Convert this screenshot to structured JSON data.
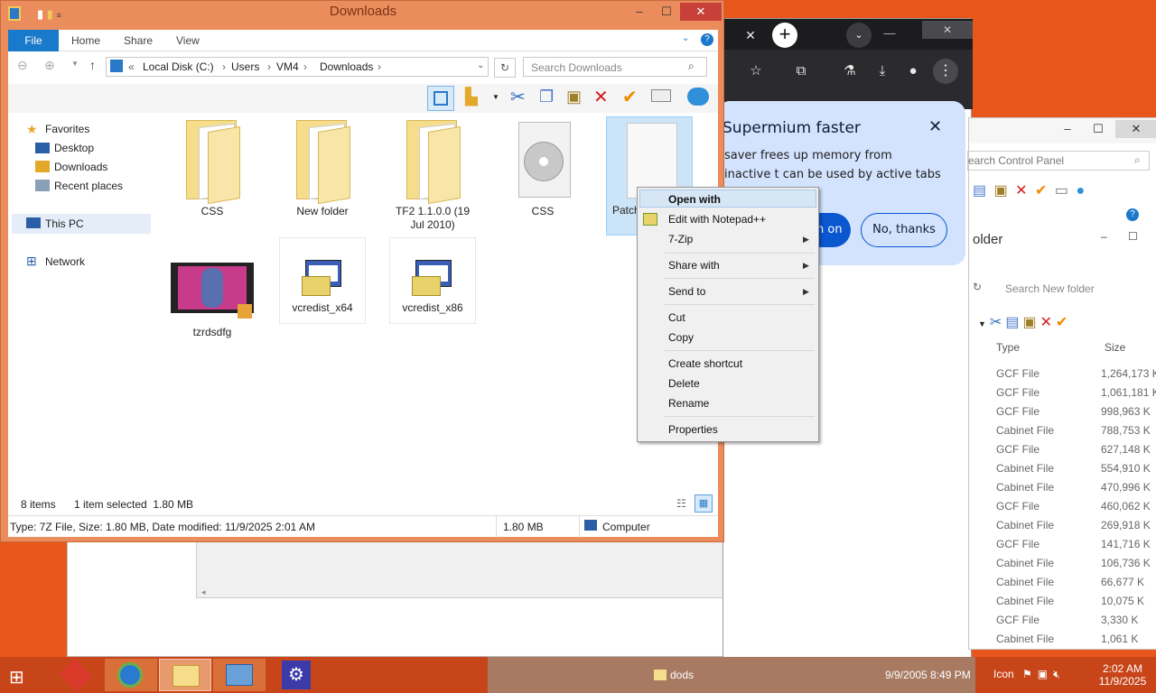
{
  "explorer": {
    "title": "Downloads",
    "ribbon_tabs": [
      "File",
      "Home",
      "Share",
      "View"
    ],
    "breadcrumb_prefix": "«",
    "breadcrumb": [
      "Local Disk (C:)",
      "Users",
      "VM4",
      "Downloads"
    ],
    "search_placeholder": "Search Downloads",
    "nav": {
      "favorites": "Favorites",
      "desktop": "Desktop",
      "downloads": "Downloads",
      "recent": "Recent places",
      "this_pc": "This PC",
      "network": "Network"
    },
    "items": [
      {
        "label": "CSS",
        "kind": "folder"
      },
      {
        "label": "New folder",
        "kind": "folder"
      },
      {
        "label": "TF2 1.1.0.0 (19 Jul 2010)",
        "kind": "folder"
      },
      {
        "label": "CSS",
        "kind": "disc-image"
      },
      {
        "label": "Patch",
        "kind": "blank-file"
      },
      {
        "label": "tzrdsdfg",
        "kind": "video"
      },
      {
        "label": "vcredist_x64",
        "kind": "installer"
      },
      {
        "label": "vcredist_x86",
        "kind": "installer"
      }
    ],
    "status": {
      "count": "8 items",
      "selection": "1 item selected  1.80 MB"
    },
    "details": {
      "info": "Type: 7Z File, Size: 1.80 MB, Date modified: 11/9/2025 2:01 AM",
      "size": "1.80 MB",
      "location": "Computer"
    }
  },
  "context_menu": {
    "items": [
      "Open with",
      "Edit with Notepad++",
      "7-Zip",
      "Share with",
      "Send to",
      "Cut",
      "Copy",
      "Create shortcut",
      "Delete",
      "Rename",
      "Properties"
    ]
  },
  "browser": {
    "promo_title": "Supermium faster",
    "promo_body": "saver frees up memory from inactive t can be used by active tabs and other",
    "promo_on": "n on",
    "promo_no": "No, thanks"
  },
  "control_panel": {
    "search_placeholder": "earch Control Panel",
    "folder_title": "older",
    "search2_placeholder": "Search New folder",
    "col_type": "Type",
    "col_size": "Size",
    "rows": [
      {
        "type": "GCF File",
        "size": "1,264,173 K"
      },
      {
        "type": "GCF File",
        "size": "1,061,181 K"
      },
      {
        "type": "GCF File",
        "size": "998,963 K"
      },
      {
        "type": "Cabinet File",
        "size": "788,753 K"
      },
      {
        "type": "GCF File",
        "size": "627,148 K"
      },
      {
        "type": "Cabinet File",
        "size": "554,910 K"
      },
      {
        "type": "Cabinet File",
        "size": "470,996 K"
      },
      {
        "type": "GCF File",
        "size": "460,062 K"
      },
      {
        "type": "Cabinet File",
        "size": "269,918 K"
      },
      {
        "type": "GCF File",
        "size": "141,716 K"
      },
      {
        "type": "Cabinet File",
        "size": "106,736 K"
      },
      {
        "type": "Cabinet File",
        "size": "66,677 K"
      },
      {
        "type": "Cabinet File",
        "size": "10,075 K"
      },
      {
        "type": "GCF File",
        "size": "3,330 K"
      },
      {
        "type": "Cabinet File",
        "size": "1,061 K"
      }
    ]
  },
  "background_window": {
    "row_label": "dods",
    "row_date": "9/9/2005 8:49 PM",
    "row_type": "Icon"
  },
  "taskbar": {
    "time": "2:02 AM",
    "date": "11/9/2025"
  },
  "colors": {
    "accent": "#1979ca",
    "titlebar": "#eb8c5d",
    "desktop": "#e8561b",
    "close": "#c7403a"
  }
}
